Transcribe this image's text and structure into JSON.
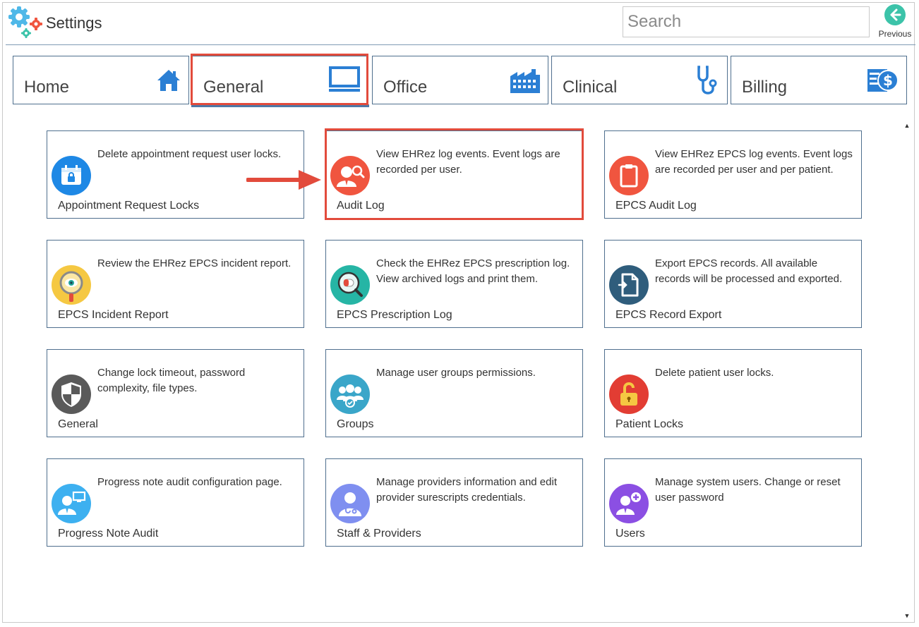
{
  "app": {
    "title": "Settings"
  },
  "search": {
    "placeholder": "Search"
  },
  "previous": {
    "label": "Previous"
  },
  "tabs": [
    {
      "label": "Home",
      "icon": "home-icon"
    },
    {
      "label": "General",
      "icon": "monitor-icon",
      "active": true
    },
    {
      "label": "Office",
      "icon": "factory-icon"
    },
    {
      "label": "Clinical",
      "icon": "stethoscope-icon"
    },
    {
      "label": "Billing",
      "icon": "billing-icon"
    }
  ],
  "cards": [
    {
      "title": "Appointment Request Locks",
      "description": "Delete appointment request user locks.",
      "icon": "calendar-lock-icon",
      "color": "#1e88e5"
    },
    {
      "title": "Audit Log",
      "description": "View EHRez log events. Event logs are recorded per user.",
      "icon": "user-search-icon",
      "color": "#f0553f"
    },
    {
      "title": "EPCS Audit Log",
      "description": "View EHRez EPCS log events. Event logs are recorded per user and per patient.",
      "icon": "clipboard-icon",
      "color": "#f0553f"
    },
    {
      "title": "EPCS Incident Report",
      "description": "Review the EHRez EPCS incident report.",
      "icon": "magnifier-eye-icon",
      "color": "#f5c842"
    },
    {
      "title": "EPCS Prescription Log",
      "description": "Check the EHRez EPCS prescription log. View archived logs and print them.",
      "icon": "pill-search-icon",
      "color": "#26b5a5"
    },
    {
      "title": "EPCS Record Export",
      "description": "Export EPCS records. All available records will be processed and exported.",
      "icon": "file-export-icon",
      "color": "#2f5d7c"
    },
    {
      "title": "General",
      "description": "Change lock timeout, password complexity, file types.",
      "icon": "shield-icon",
      "color": "#5a5a5a"
    },
    {
      "title": "Groups",
      "description": "Manage user groups permissions.",
      "icon": "users-group-icon",
      "color": "#3aa6c9"
    },
    {
      "title": "Patient Locks",
      "description": "Delete patient user locks.",
      "icon": "unlock-icon",
      "color": "#e23d33"
    },
    {
      "title": "Progress Note Audit",
      "description": "Progress note audit configuration page.",
      "icon": "user-monitor-icon",
      "color": "#3db0f0"
    },
    {
      "title": "Staff & Providers",
      "description": "Manage providers information and edit provider surescripts credentials.",
      "icon": "doctor-icon",
      "color": "#7f8ff0"
    },
    {
      "title": "Users",
      "description": "Manage system users. Change or reset user password",
      "icon": "user-add-icon",
      "color": "#8b4fe3"
    }
  ],
  "colors": {
    "accent": "#4f79a6",
    "highlight": "#e24b3c",
    "border": "#4f6f8e"
  }
}
